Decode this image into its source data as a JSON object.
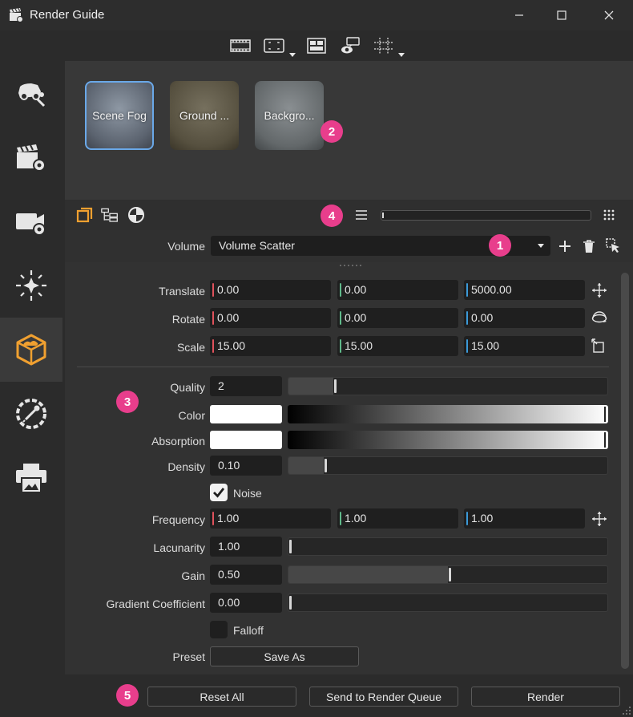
{
  "window": {
    "title": "Render Guide"
  },
  "toolbar": {
    "icons": [
      "film-icon",
      "frame-icon",
      "layout-icon",
      "camera-view-icon",
      "grid-icon"
    ]
  },
  "sidebar": {
    "items": [
      {
        "icon": "scene-tools-icon",
        "active": false
      },
      {
        "icon": "clapboard-settings-icon",
        "active": false
      },
      {
        "icon": "camera-settings-icon",
        "active": false
      },
      {
        "icon": "light-icon",
        "active": false
      },
      {
        "icon": "volume-cube-icon",
        "active": true
      },
      {
        "icon": "dropper-dial-icon",
        "active": false
      },
      {
        "icon": "printer-icon",
        "active": false
      }
    ]
  },
  "thumbnails": [
    {
      "label": "Scene Fog",
      "selected": true
    },
    {
      "label": "Ground ...",
      "selected": false
    },
    {
      "label": "Backgro...",
      "selected": false
    }
  ],
  "badges": [
    "1",
    "2",
    "3",
    "4",
    "5"
  ],
  "volume": {
    "label": "Volume",
    "selected": "Volume Scatter"
  },
  "transform": {
    "translate": {
      "label": "Translate",
      "x": "0.00",
      "y": "0.00",
      "z": "5000.00"
    },
    "rotate": {
      "label": "Rotate",
      "x": "0.00",
      "y": "0.00",
      "z": "0.00"
    },
    "scale": {
      "label": "Scale",
      "x": "15.00",
      "y": "15.00",
      "z": "15.00"
    }
  },
  "props": {
    "quality": {
      "label": "Quality",
      "value": "2",
      "level": 0.14
    },
    "color": {
      "label": "Color",
      "swatch": "#ffffff",
      "level": 1.0
    },
    "absorption": {
      "label": "Absorption",
      "swatch": "#ffffff",
      "level": 1.0
    },
    "density": {
      "label": "Density",
      "value": "0.10",
      "level": 0.11
    },
    "noise": {
      "label": "Noise",
      "checked": true
    },
    "frequency": {
      "label": "Frequency",
      "x": "1.00",
      "y": "1.00",
      "z": "1.00"
    },
    "lacunarity": {
      "label": "Lacunarity",
      "value": "1.00",
      "level": 0.0
    },
    "gain": {
      "label": "Gain",
      "value": "0.50",
      "level": 0.5
    },
    "gradient": {
      "label": "Gradient Coefficient",
      "value": "0.00",
      "level": 0.0
    },
    "falloff": {
      "label": "Falloff",
      "checked": false
    },
    "preset": {
      "label": "Preset",
      "button": "Save As"
    }
  },
  "footer": {
    "reset": "Reset All",
    "queue": "Send to Render Queue",
    "render": "Render"
  },
  "colors": {
    "x_axis": "#e0525c",
    "y_axis": "#5fb98a",
    "z_axis": "#3b9ad9",
    "accent": "#f0a030",
    "badge": "#e83e8c"
  }
}
